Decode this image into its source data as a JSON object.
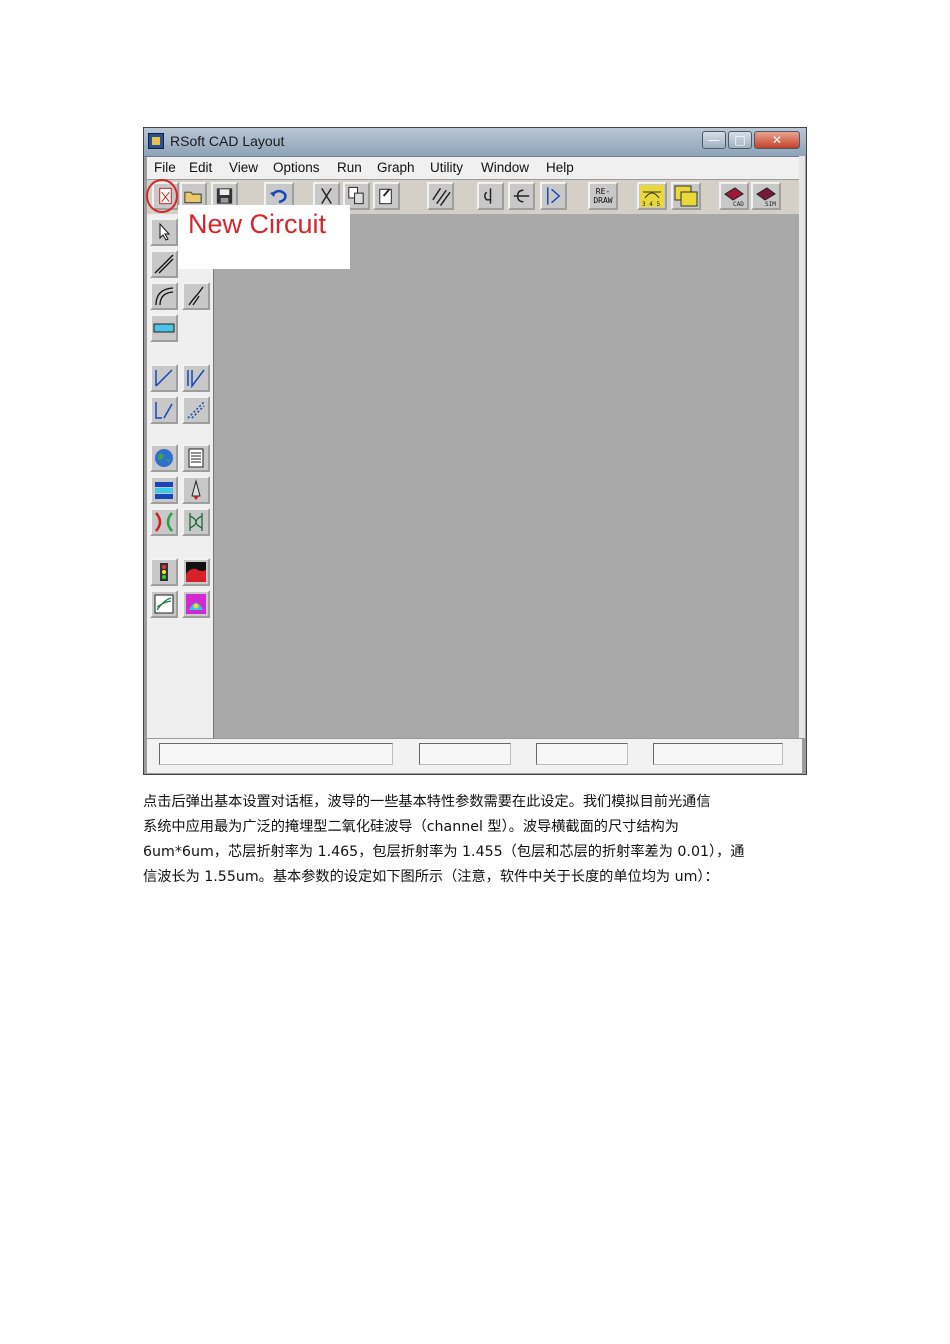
{
  "window": {
    "title": "RSoft CAD Layout",
    "controls": {
      "minimize": "—",
      "maximize": "□",
      "close": "✕"
    }
  },
  "menu": [
    "File",
    "Edit",
    "View",
    "Options",
    "Run",
    "Graph",
    "Utility",
    "Window",
    "Help"
  ],
  "toolbar": {
    "buttons": [
      {
        "name": "new-circuit",
        "icon": "new-file-icon"
      },
      {
        "name": "open",
        "icon": "folder-open-icon"
      },
      {
        "name": "save",
        "icon": "floppy-icon"
      },
      {
        "name": "undo",
        "icon": "undo-icon"
      },
      {
        "name": "cut",
        "icon": "scissors-icon"
      },
      {
        "name": "copy",
        "icon": "copy-icon"
      },
      {
        "name": "paste",
        "icon": "paste-icon"
      },
      {
        "name": "array",
        "icon": "hatch-icon"
      },
      {
        "name": "rotate",
        "icon": "rotate-icon"
      },
      {
        "name": "flip",
        "icon": "flip-icon"
      },
      {
        "name": "mirror",
        "icon": "mirror-icon"
      },
      {
        "name": "redraw",
        "icon": "redraw-icon"
      },
      {
        "name": "display",
        "icon": "display-icon"
      },
      {
        "name": "windows",
        "icon": "windows-icon"
      },
      {
        "name": "cad",
        "icon": "cad-book-icon"
      },
      {
        "name": "sim",
        "icon": "sim-book-icon"
      }
    ],
    "redraw_label": "RE-\nDRAW",
    "cad_label": "CAD",
    "sim_label": "SIM",
    "display_label": "3 4 5"
  },
  "left_tools": [
    "pointer-icon",
    "straight-segment-icon",
    "arc-segment-icon",
    "s-bend-icon",
    "text-label-icon",
    "edit-vertex-icon",
    "taper-icon",
    "extend-icon",
    "offset-icon",
    "globe-icon",
    "notes-icon",
    "layers-icon",
    "launch-icon",
    "coupler-icon",
    "mode-icon",
    "monitor-icon",
    "profile-icon",
    "graph-icon",
    "mode-view-icon"
  ],
  "status_fields": [
    "",
    "",
    "",
    ""
  ],
  "callout": {
    "text": "New Circuit"
  },
  "paragraph": {
    "lines": [
      "点击后弹出基本设置对话框，波导的一些基本特性参数需要在此设定。我们模拟目前光通信",
      "系统中应用最为广泛的掩埋型二氧化硅波导（channel  型）。波导横截面的尺寸结构为",
      "6um*6um，芯层折射率为 1.465，包层折射率为 1.455（包层和芯层的折射率差为 0.01），通",
      "信波长为 1.55um。基本参数的设定如下图所示（注意，软件中关于长度的单位均为 um）："
    ]
  }
}
